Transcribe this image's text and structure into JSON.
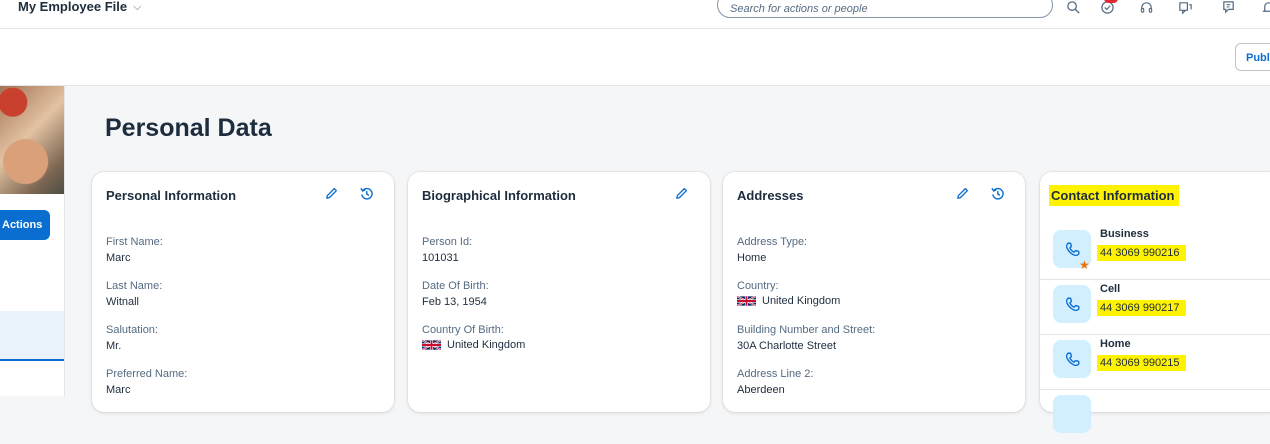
{
  "shell": {
    "title": "My Employee File",
    "search_placeholder": "Search for actions or people"
  },
  "header": {
    "publish_label": "Publi"
  },
  "left": {
    "actions_label": "Actions"
  },
  "page": {
    "title": "Personal Data"
  },
  "personal_information": {
    "title": "Personal Information",
    "fields": [
      {
        "label": "First Name:",
        "value": "Marc"
      },
      {
        "label": "Last Name:",
        "value": "Witnall"
      },
      {
        "label": "Salutation:",
        "value": "Mr."
      },
      {
        "label": "Preferred Name:",
        "value": "Marc"
      }
    ]
  },
  "biographical_information": {
    "title": "Biographical Information",
    "fields": [
      {
        "label": "Person Id:",
        "value": "101031"
      },
      {
        "label": "Date Of Birth:",
        "value": "Feb 13, 1954"
      },
      {
        "label": "Country Of Birth:",
        "value": "United Kingdom"
      }
    ]
  },
  "addresses": {
    "title": "Addresses",
    "fields": [
      {
        "label": "Address Type:",
        "value": "Home"
      },
      {
        "label": "Country:",
        "value": "United Kingdom"
      },
      {
        "label": "Building Number and Street:",
        "value": "30A Charlotte Street"
      },
      {
        "label": "Address Line 2:",
        "value": "Aberdeen"
      }
    ]
  },
  "contact_information": {
    "title": "Contact Information",
    "phones": [
      {
        "type": "Business",
        "number": "44 3069 990216",
        "primary": true
      },
      {
        "type": "Cell",
        "number": "44 3069 990217",
        "primary": false
      },
      {
        "type": "Home",
        "number": "44 3069 990215",
        "primary": false
      }
    ]
  },
  "colors": {
    "accent": "#0a6ed1",
    "highlight": "#fff200",
    "notification_badge": "#e0282e",
    "primary_star": "#e9730c"
  },
  "icons": [
    "chevron-down-icon",
    "search-icon",
    "notification-icon",
    "headset-icon",
    "product-switch-icon",
    "feedback-icon",
    "bell-icon",
    "edit-icon",
    "history-icon",
    "phone-icon",
    "star-icon",
    "uk-flag-icon"
  ]
}
